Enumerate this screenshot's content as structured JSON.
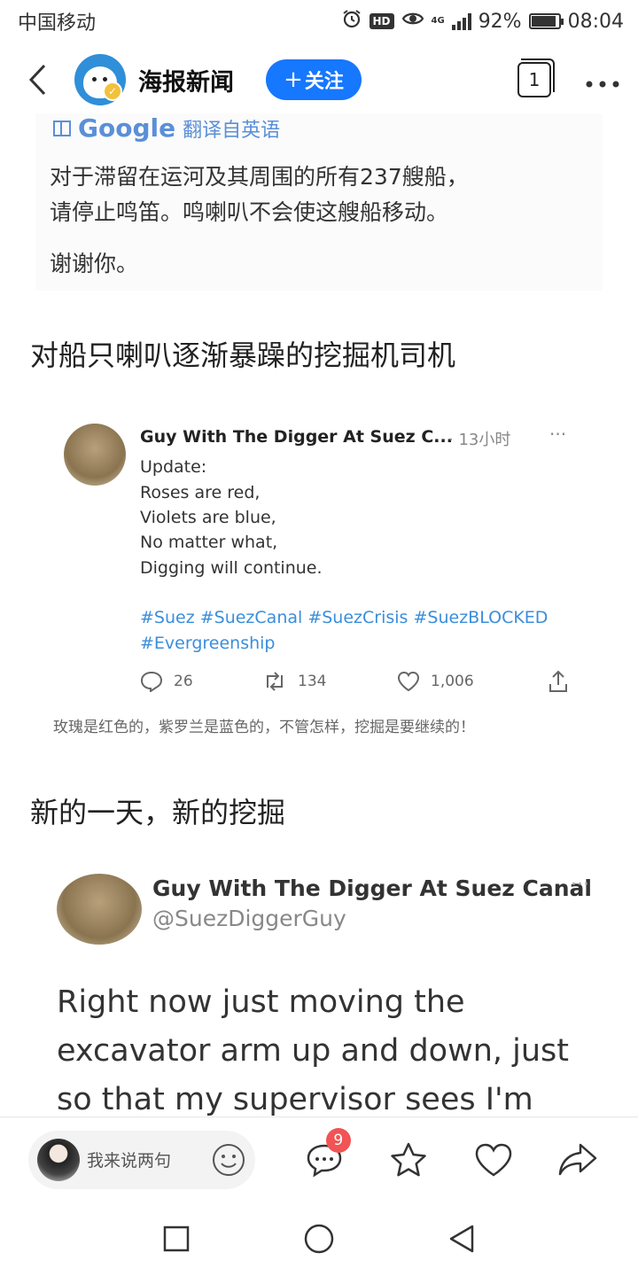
{
  "status_bar": {
    "carrier": "中国移动",
    "hd": "HD",
    "network": "4G",
    "battery": "92%",
    "battery_level": 0.92,
    "time": "08:04"
  },
  "header": {
    "account_name": "海报新闻",
    "follow_label": "关注",
    "tab_count": "1",
    "accent_color": "#1677ff"
  },
  "content": {
    "translate_screenshot": {
      "translate_label": "翻译自英语",
      "google_label": "Google",
      "lines": [
        "对于滞留在运河及其周围的所有237艘船，",
        "请停止鸣笛。鸣喇叭不会使这艘船移动。"
      ],
      "thanks": "谢谢你。"
    },
    "caption1": "对船只喇叭逐渐暴躁的挖掘机司机",
    "tweet1": {
      "name": "Guy With The Digger At Suez C...",
      "time": "· 13小时",
      "more": "···",
      "lines": [
        "Update:",
        "Roses are red,",
        "Violets are blue,",
        "No matter what,",
        "Digging will continue."
      ],
      "hashtags": [
        "#Suez #SuezCanal #SuezCrisis #SuezBLOCKED",
        "#Evergreenship"
      ],
      "replies": "26",
      "retweets": "134",
      "likes": "1,006",
      "translation": "玫瑰是红色的，紫罗兰是蓝色的，不管怎样，挖掘是要继续的！"
    },
    "caption2": "新的一天，新的挖掘",
    "tweet2": {
      "name": "Guy With The Digger At Suez Canal",
      "handle": "@SuezDiggerGuy",
      "more": "···",
      "body": "Right now just moving the excavator arm up and down, just so that my supervisor sees I'm working. Not"
    }
  },
  "bottom_bar": {
    "comment_placeholder": "我来说两句",
    "comment_count": "9"
  },
  "nav_icons": [
    "square-icon",
    "circle-icon",
    "triangle-back-icon"
  ]
}
